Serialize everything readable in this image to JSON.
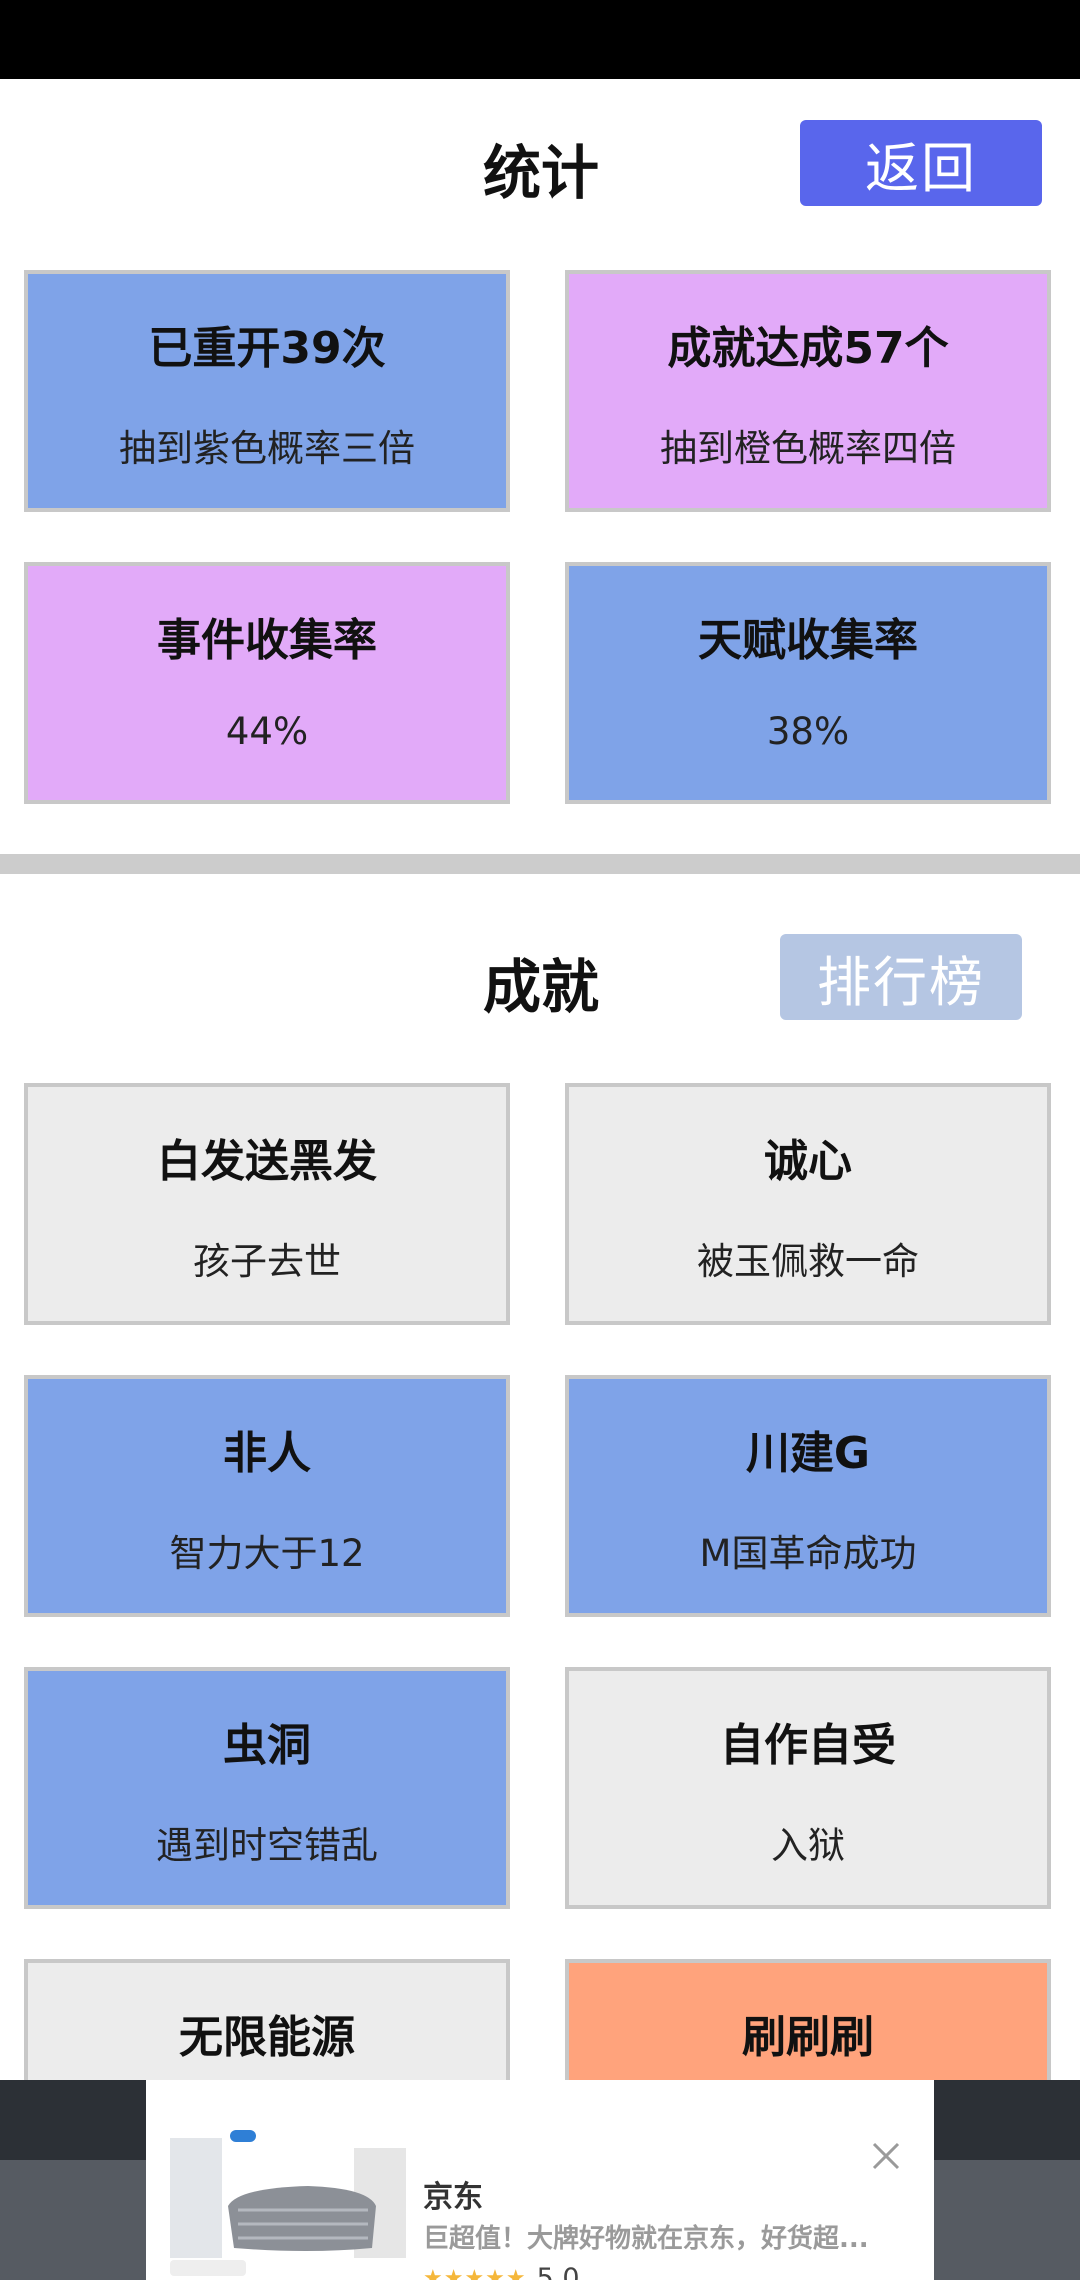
{
  "stats": {
    "title": "统计",
    "back_label": "返回",
    "cards": [
      {
        "title": "已重开39次",
        "desc": "抽到紫色概率三倍",
        "color": "#7fa3e8"
      },
      {
        "title": "成就达成57个",
        "desc": "抽到橙色概率四倍",
        "color": "#e2aaf9"
      },
      {
        "title": "事件收集率",
        "desc": "44%",
        "color": "#e2aaf9"
      },
      {
        "title": "天赋收集率",
        "desc": "38%",
        "color": "#7fa3e8"
      }
    ]
  },
  "achievements": {
    "title": "成就",
    "ranking_label": "排行榜",
    "items": [
      {
        "title": "白发送黑发",
        "desc": "孩子去世",
        "color": "#ececec"
      },
      {
        "title": "诚心",
        "desc": "被玉佩救一命",
        "color": "#ececec"
      },
      {
        "title": "非人",
        "desc": "智力大于12",
        "color": "#7fa3e8"
      },
      {
        "title": "川建G",
        "desc": "M国革命成功",
        "color": "#7fa3e8"
      },
      {
        "title": "虫洞",
        "desc": "遇到时空错乱",
        "color": "#7fa3e8"
      },
      {
        "title": "自作自受",
        "desc": "入狱",
        "color": "#ececec"
      },
      {
        "title": "无限能源",
        "desc": "",
        "color": "#ececec"
      },
      {
        "title": "刷刷刷",
        "desc": "",
        "color": "#ffa37c"
      }
    ]
  },
  "ad": {
    "brand": "京东",
    "desc": "巨超值！大牌好物就在京东，好货超...",
    "stars": "★★★★★",
    "score": "5.0"
  },
  "colors": {
    "accent": "#5966ec",
    "ranking_disabled": "#b5c6e3",
    "divider": "#cccccc"
  }
}
